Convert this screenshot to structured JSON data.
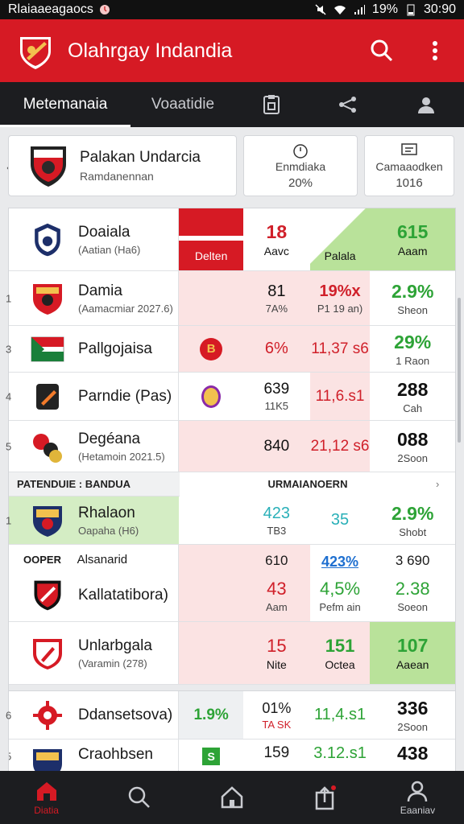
{
  "status_bar": {
    "carrier": "Rlaiaaeagaocs",
    "battery": "19%",
    "time": "30:90"
  },
  "app_bar": {
    "title": "Olahrgay Indandia"
  },
  "tabs": [
    {
      "label": "Metemanaia",
      "active": true
    },
    {
      "label": "Voaatidie",
      "active": false
    },
    {
      "icon": "clipboard-icon"
    },
    {
      "icon": "share-icon"
    },
    {
      "icon": "user-icon"
    }
  ],
  "summary": {
    "team": {
      "name": "Palakan Undarcia",
      "sub": "Ramdanennan"
    },
    "stat1": {
      "label": "Enmdiaka",
      "value": "20%"
    },
    "stat2": {
      "label": "Camaaodken",
      "value": "1016"
    }
  },
  "header_row": {
    "team": {
      "name": "Doaiala",
      "sub": "(Aatian (Ha6)"
    },
    "badge": "Delten",
    "col_b": {
      "top": "18",
      "bottom": "Aavc"
    },
    "col_c": {
      "bottom": "Palala"
    },
    "col_d": {
      "top": "615",
      "bottom": "Aaam"
    }
  },
  "rows": [
    {
      "rank": "1",
      "name": "Damia",
      "sub": "(Aamacmiar 2027.6)",
      "col_b": {
        "top": "81",
        "bottom": "7A%"
      },
      "col_c": {
        "top": "19%x",
        "bottom": "P1 19 an)"
      },
      "col_d": {
        "top": "2.9%",
        "bottom": "Sheon"
      }
    },
    {
      "rank": "3",
      "name": "Pallgojaisa",
      "sub": "",
      "col_a": "B",
      "col_b": {
        "top": "6%",
        "bottom": ""
      },
      "col_c": {
        "top": "11,37 s6",
        "bottom": ""
      },
      "col_d": {
        "top": "29%",
        "bottom": "1 Raon"
      }
    },
    {
      "rank": "4",
      "name": "Parndie (Pas)",
      "sub": "",
      "col_a": "",
      "col_b": {
        "top": "639",
        "bottom": "11K5"
      },
      "col_c": {
        "top": "11,6.s1",
        "bottom": ""
      },
      "col_d": {
        "top": "288",
        "bottom": "Cah"
      }
    },
    {
      "rank": "5",
      "name": "Degéana",
      "sub": "(Hetamoin 2021.5)",
      "col_b": {
        "top": "840",
        "bottom": ""
      },
      "col_c": {
        "top": "21,12 s6",
        "bottom": ""
      },
      "col_d": {
        "top": "088",
        "bottom": "2Soon"
      }
    }
  ],
  "divider": {
    "left": "PATENDUIE : BANDUA",
    "right": "URMAIANOERN"
  },
  "rows2": [
    {
      "rank": "1",
      "name": "Rhalaon",
      "sub": "Oapaha (H6)",
      "col_b": {
        "top": "423",
        "bottom": "TB3"
      },
      "col_c": {
        "top": "35",
        "bottom": ""
      },
      "col_d": {
        "top": "2.9%",
        "bottom": "Shobt"
      }
    },
    {
      "rank": "",
      "tag": "OOPER",
      "tag2": "Alsanarid",
      "name": "Kallatatibora)",
      "sub": "",
      "col_b": {
        "top": "610",
        "top2": "43",
        "bottom": "Aam"
      },
      "col_c": {
        "top": "423%",
        "top2": "4,5%",
        "bottom": "Pefm ain"
      },
      "col_d": {
        "top": "3 690",
        "top2": "2.38",
        "bottom": "Soeon"
      }
    },
    {
      "rank": "",
      "name": "Unlarbgala",
      "sub": "(Varamin (278)",
      "col_b": {
        "top": "15",
        "bottom": "Nite"
      },
      "col_c": {
        "top": "151",
        "bottom": "Octea"
      },
      "col_d": {
        "top": "107",
        "bottom": "Aaean"
      }
    }
  ],
  "rows3": [
    {
      "rank": "6",
      "name": "Ddansetsova)",
      "col_a": "1.9%",
      "col_b": {
        "top": "01%",
        "bottom": "TA SK"
      },
      "col_c": {
        "top": "11,4.s1",
        "bottom": ""
      },
      "col_d": {
        "top": "336",
        "bottom": "2Soon"
      }
    },
    {
      "rank": "5",
      "name": "Craohbsen",
      "col_a": "S",
      "col_b": {
        "top": "159",
        "bottom": ""
      },
      "col_c": {
        "top": "3.12.s1",
        "bottom": ""
      },
      "col_d": {
        "top": "438",
        "bottom": ""
      }
    }
  ],
  "bottom_nav": [
    {
      "label": "Diatia",
      "icon": "home-icon",
      "active": true
    },
    {
      "label": "",
      "icon": "search-icon",
      "active": false
    },
    {
      "label": "",
      "icon": "house-icon",
      "active": false
    },
    {
      "label": "",
      "icon": "share-box-icon",
      "active": false
    },
    {
      "label": "Eaaniav",
      "icon": "profile-icon",
      "active": false
    }
  ],
  "colors": {
    "brand_red": "#d61a24",
    "dark": "#1c1d20",
    "green": "#2da336",
    "pink": "#fbe3e3",
    "light_green": "#d4edc4"
  }
}
